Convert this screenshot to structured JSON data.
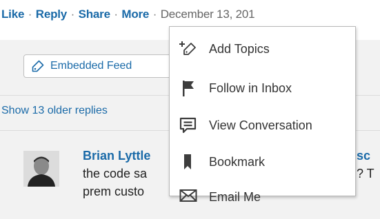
{
  "actions": {
    "like": "Like",
    "reply": "Reply",
    "share": "Share",
    "more": "More",
    "separator": "·",
    "date": "December 13, 201"
  },
  "embed_pill": {
    "label": "Embedded Feed",
    "icon": "tag-icon"
  },
  "show_older": "Show 13 older replies",
  "comment": {
    "author": "Brian Lyttle",
    "author_tail": "sc",
    "line1": "the code sa",
    "line1_tail": "? T",
    "line2": "prem custo"
  },
  "more_menu": {
    "items": [
      {
        "label": "Add Topics",
        "icon": "add-topic-icon"
      },
      {
        "label": "Follow in Inbox",
        "icon": "flag-icon"
      },
      {
        "label": "View Conversation",
        "icon": "conversation-icon"
      },
      {
        "label": "Bookmark",
        "icon": "bookmark-icon"
      },
      {
        "label": "Email Me",
        "icon": "envelope-icon"
      }
    ]
  },
  "colors": {
    "link": "#1a6aa8",
    "panel": "#f2f2f2",
    "icon": "#3d3d3d"
  }
}
